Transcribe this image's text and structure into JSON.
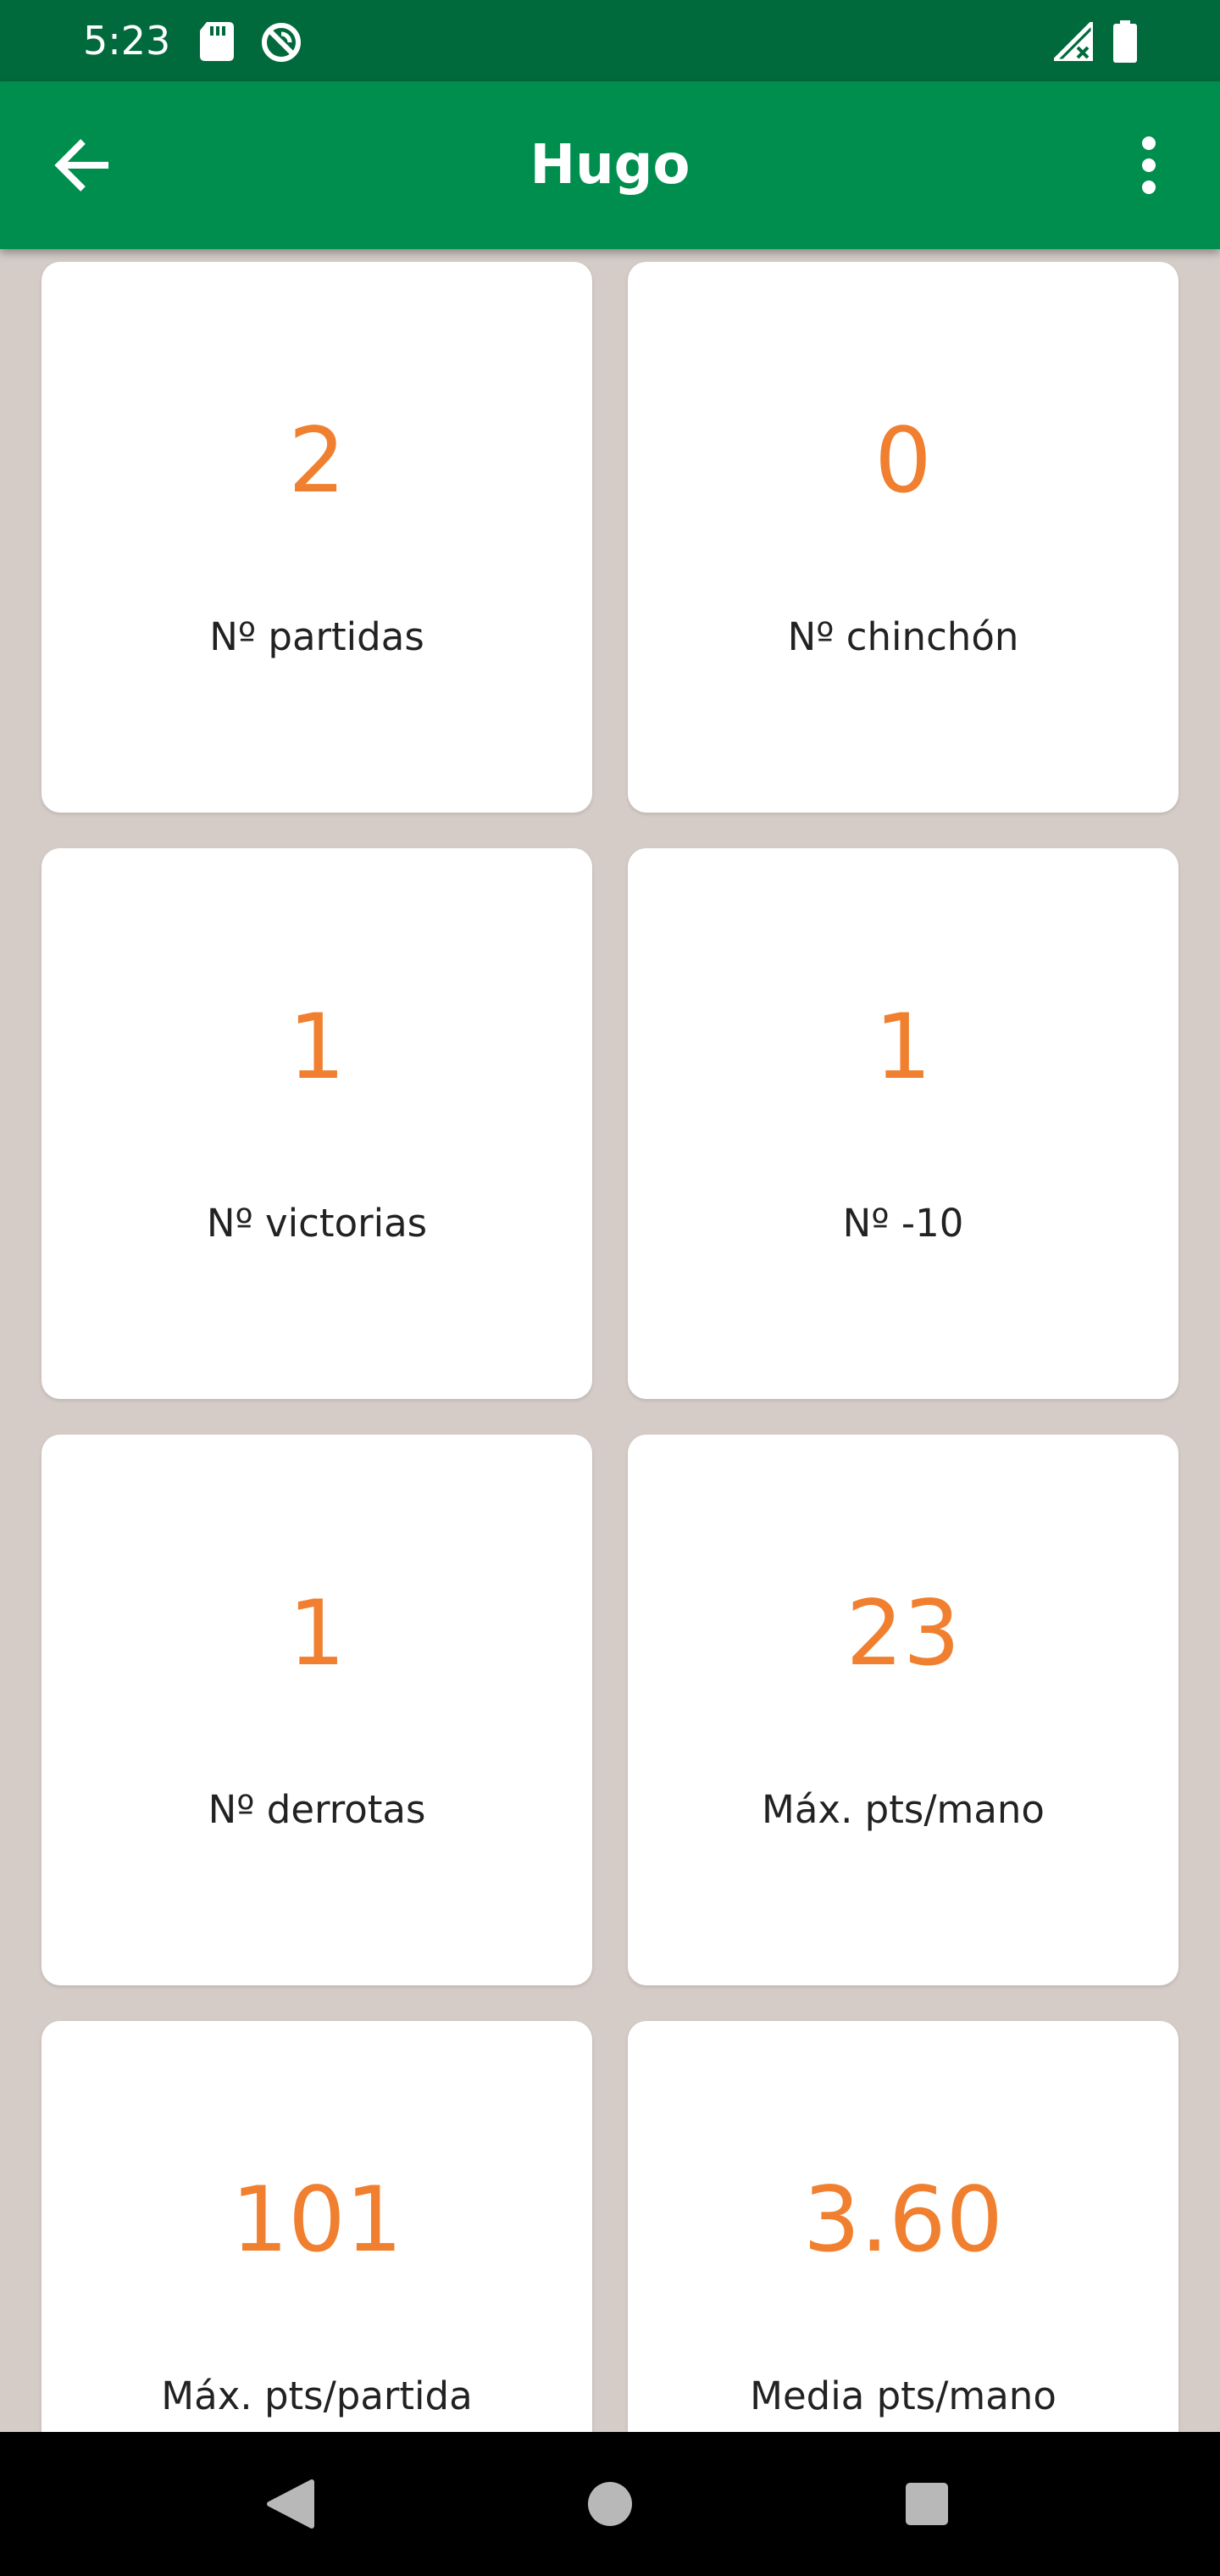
{
  "status_bar": {
    "time": "5:23",
    "icons": [
      "sd-card-icon",
      "sync-disabled-icon",
      "signal-no-data-icon",
      "battery-icon"
    ]
  },
  "app_bar": {
    "title": "Hugo",
    "back_icon": "arrow-back-icon",
    "menu_icon": "more-vertical-icon"
  },
  "colors": {
    "status_bar": "#006a3c",
    "app_bar": "#008e4e",
    "background": "#d5ccc8",
    "value_accent": "#f08030"
  },
  "stats": [
    {
      "value": "2",
      "label": "Nº partidas"
    },
    {
      "value": "0",
      "label": "Nº chinchón"
    },
    {
      "value": "1",
      "label": "Nº victorias"
    },
    {
      "value": "1",
      "label": "Nº -10"
    },
    {
      "value": "1",
      "label": "Nº derrotas"
    },
    {
      "value": "23",
      "label": "Máx. pts/mano"
    },
    {
      "value": "101",
      "label": "Máx. pts/partida"
    },
    {
      "value": "3.60",
      "label": "Media pts/mano"
    }
  ],
  "nav_bar": {
    "icons": [
      "back-triangle-icon",
      "home-circle-icon",
      "recents-square-icon"
    ]
  }
}
